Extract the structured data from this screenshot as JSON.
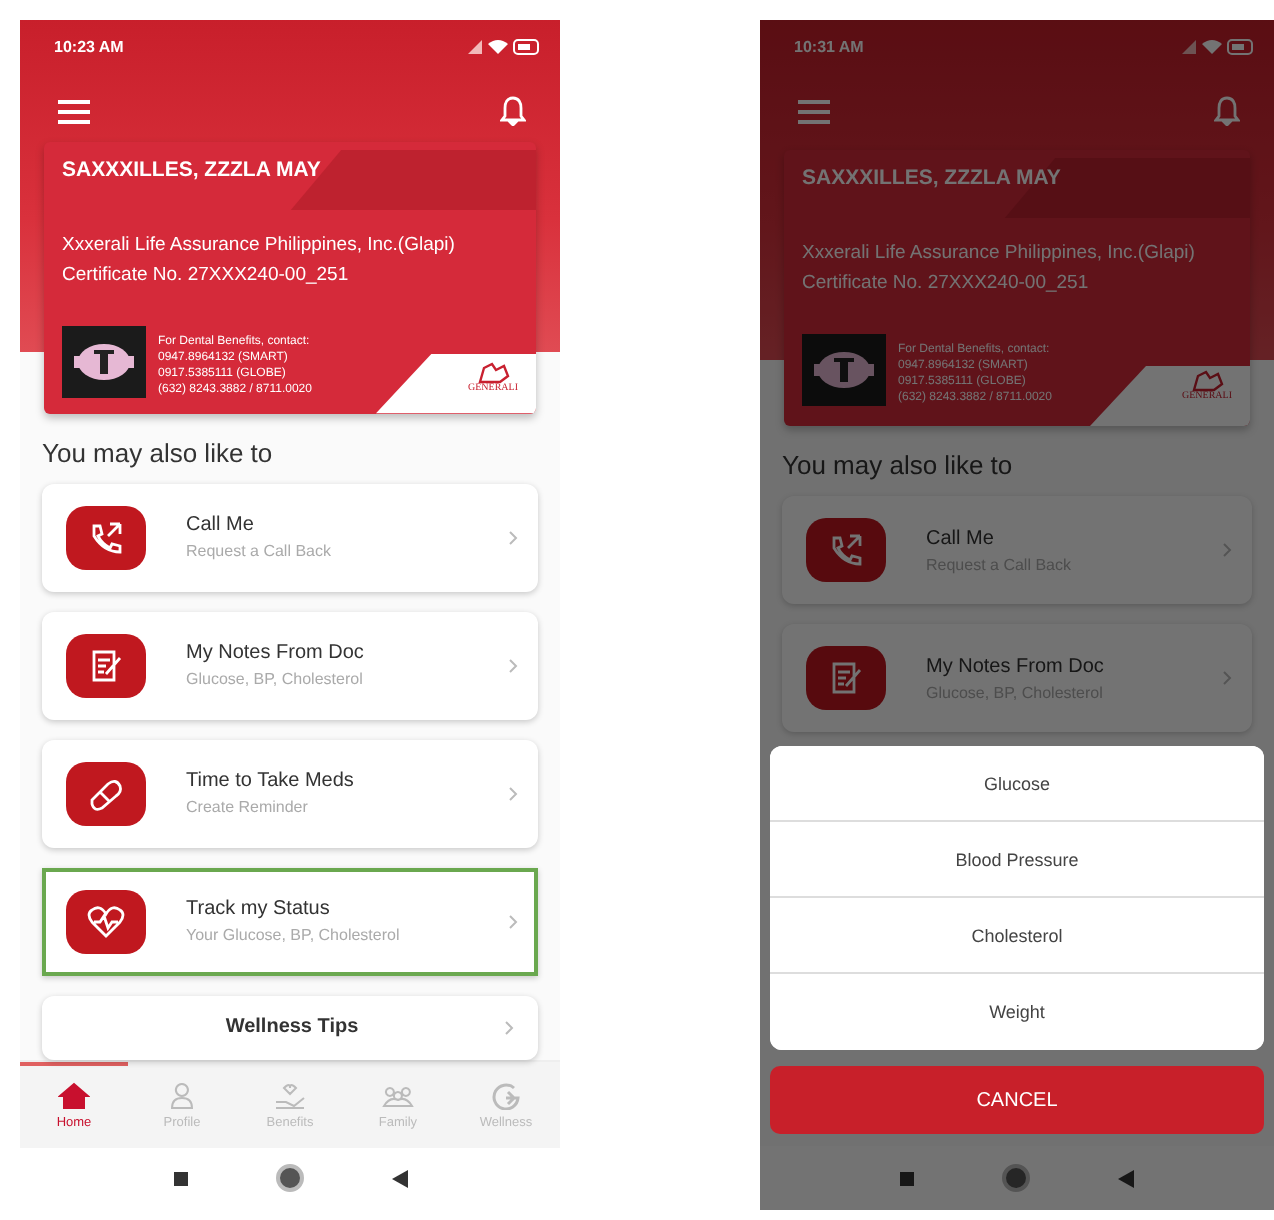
{
  "screens": [
    {
      "status_time": "10:23 AM",
      "card": {
        "name": "SAXXXILLES, ZZZLA MAY",
        "company": "Xxxerali Life Assurance Philippines, Inc.(Glapi)",
        "certificate": "Certificate No. 27XXX240-00_251",
        "contact_lines": [
          "For Dental Benefits, contact:",
          "0947.8964132 (SMART)",
          "0917.5385111 (GLOBE)",
          "(632) 8243.3882 / 8711.0020"
        ],
        "logo_text": "GENERALI"
      },
      "section_title": "You may also like to",
      "items": [
        {
          "kind": "feature",
          "title": "Call Me",
          "subtitle": "Request a Call Back",
          "highlighted": false
        },
        {
          "kind": "feature",
          "title": "My Notes From Doc",
          "subtitle": "Glucose, BP, Cholesterol",
          "highlighted": false
        },
        {
          "kind": "feature",
          "title": "Time to Take Meds",
          "subtitle": "Create Reminder",
          "highlighted": false
        },
        {
          "kind": "feature",
          "title": "Track my Status",
          "subtitle": "Your Glucose, BP, Cholesterol",
          "highlighted": true
        },
        {
          "kind": "link",
          "title": "Wellness Tips",
          "highlighted": false
        }
      ],
      "nav": [
        {
          "label": "Home",
          "selected": true
        },
        {
          "label": "Profile",
          "selected": false
        },
        {
          "label": "Benefits",
          "selected": false
        },
        {
          "label": "Family",
          "selected": false
        },
        {
          "label": "Wellness",
          "selected": false
        }
      ]
    },
    {
      "status_time": "10:31 AM",
      "card": {
        "name": "SAXXXILLES, ZZZLA MAY",
        "company": "Xxxerali Life Assurance Philippines, Inc.(Glapi)",
        "certificate": "Certificate No. 27XXX240-00_251",
        "contact_lines": [
          "For Dental Benefits, contact:",
          "0947.8964132 (SMART)",
          "0917.5385111 (GLOBE)",
          "(632) 8243.3882 / 8711.0020"
        ],
        "logo_text": "GENERALI"
      },
      "section_title": "You may also like to",
      "items": [
        {
          "kind": "feature",
          "title": "Call Me",
          "subtitle": "Request a Call Back",
          "highlighted": false
        },
        {
          "kind": "feature",
          "title": "My Notes From Doc",
          "subtitle": "Glucose, BP, Cholesterol",
          "highlighted": false
        }
      ],
      "action_sheet": {
        "options": [
          "Glucose",
          "Blood Pressure",
          "Cholesterol",
          "Weight"
        ],
        "cancel": "CANCEL"
      }
    }
  ]
}
